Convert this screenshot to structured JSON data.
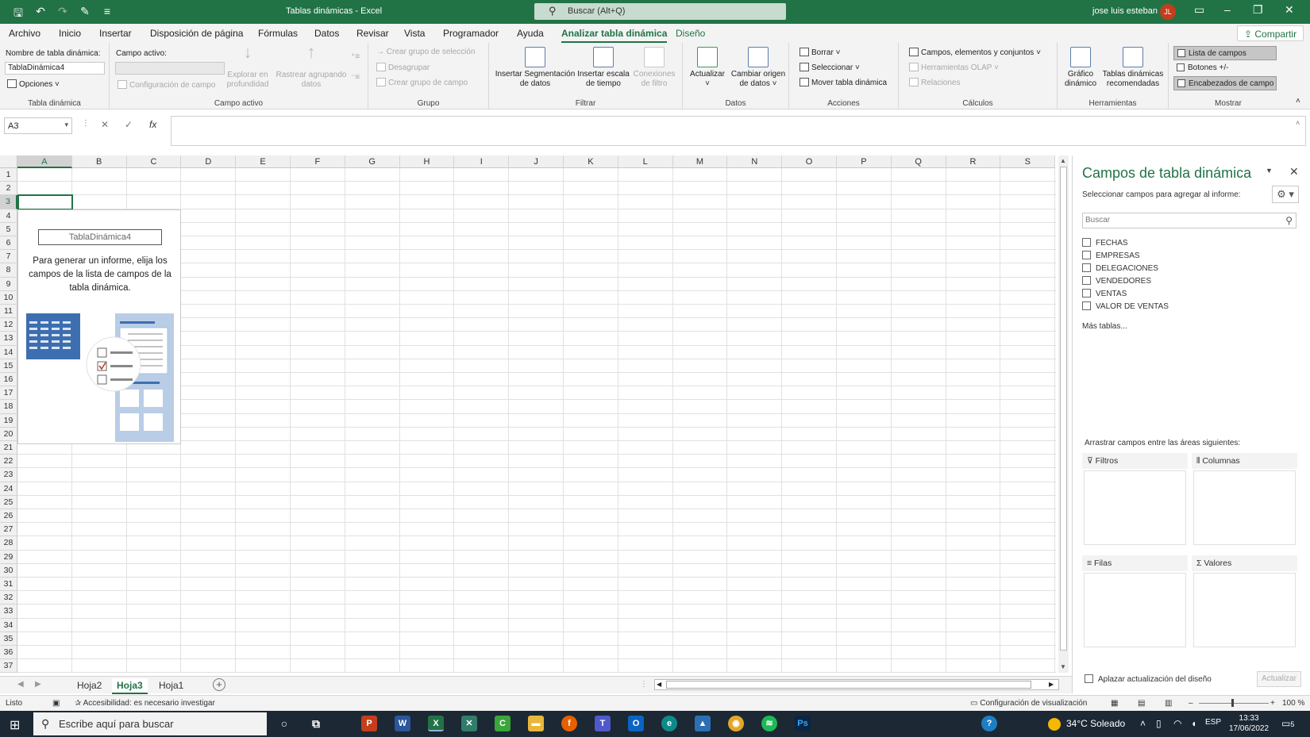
{
  "titlebar": {
    "title": "Tablas dinámicas  -  Excel",
    "search_placeholder": "Buscar (Alt+Q)",
    "user": "jose luis esteban",
    "initials": "JL"
  },
  "menu": {
    "tabs": [
      "Archivo",
      "Inicio",
      "Insertar",
      "Disposición de página",
      "Fórmulas",
      "Datos",
      "Revisar",
      "Vista",
      "Programador",
      "Ayuda",
      "Analizar tabla dinámica",
      "Diseño"
    ],
    "share": "Compartir"
  },
  "ribbon": {
    "tabla": {
      "name_label": "Nombre de tabla dinámica:",
      "name_value": "TablaDinámica4",
      "options": "Opciones",
      "group": "Tabla dinámica"
    },
    "campo": {
      "label": "Campo activo:",
      "config": "Configuración de campo",
      "explore": "Explorar en profundidad",
      "drill": "Rastrear agrupando datos",
      "group": "Campo activo"
    },
    "grupo": {
      "sel": "Crear grupo de selección",
      "desagrupar": "Desagrupar",
      "campo": "Crear grupo de campo",
      "group": "Grupo"
    },
    "filtrar": {
      "seg": "Insertar Segmentación de datos",
      "escala": "Insertar escala de tiempo",
      "conex": "Conexiones de filtro",
      "group": "Filtrar"
    },
    "datos": {
      "act": "Actualizar",
      "origen": "Cambiar origen de datos",
      "group": "Datos"
    },
    "acciones": {
      "borrar": "Borrar",
      "sel": "Seleccionar",
      "mover": "Mover tabla dinámica",
      "group": "Acciones"
    },
    "calculos": {
      "campos": "Campos, elementos y conjuntos",
      "olap": "Herramientas OLAP",
      "rel": "Relaciones",
      "group": "Cálculos"
    },
    "herr": {
      "graf": "Gráfico dinámico",
      "rec": "Tablas dinámicas recomendadas",
      "group": "Herramientas"
    },
    "mostrar": {
      "lista": "Lista de campos",
      "botones": "Botones +/-",
      "encab": "Encabezados de campo",
      "group": "Mostrar"
    }
  },
  "formula": {
    "namebox": "A3",
    "fx": "fx"
  },
  "grid": {
    "columns": [
      "A",
      "B",
      "C",
      "D",
      "E",
      "F",
      "G",
      "H",
      "I",
      "J",
      "K",
      "L",
      "M",
      "N",
      "O",
      "P",
      "Q",
      "R",
      "S"
    ],
    "rows": [
      "1",
      "2",
      "3",
      "4",
      "5",
      "6",
      "7",
      "8",
      "9",
      "10",
      "11",
      "12",
      "13",
      "14",
      "15",
      "16",
      "17",
      "18",
      "19",
      "20",
      "21",
      "22",
      "23",
      "24",
      "25",
      "26",
      "27",
      "28",
      "29",
      "30",
      "31",
      "32",
      "33",
      "34",
      "35",
      "36",
      "37"
    ]
  },
  "pivot": {
    "name": "TablaDinámica4",
    "message": "Para generar un informe, elija los campos de la lista de campos de la tabla dinámica."
  },
  "sheets": {
    "tabs": [
      "Hoja2",
      "Hoja3",
      "Hoja1"
    ],
    "active": "Hoja3"
  },
  "status": {
    "ready": "Listo",
    "access": "Accesibilidad: es necesario investigar",
    "display": "Configuración de visualización",
    "zoom": "100 %"
  },
  "panel": {
    "title": "Campos de tabla dinámica",
    "subtitle": "Seleccionar campos para agregar al informe:",
    "search": "Buscar",
    "fields": [
      "FECHAS",
      "EMPRESAS",
      "DELEGACIONES",
      "VENDEDORES",
      "VENTAS",
      "VALOR DE VENTAS"
    ],
    "more": "Más tablas...",
    "drag": "Arrastrar campos entre las áreas siguientes:",
    "areas": {
      "filtros": "Filtros",
      "columnas": "Columnas",
      "filas": "Filas",
      "valores": "Valores"
    },
    "defer": "Aplazar actualización del diseño",
    "update": "Actualizar"
  },
  "taskbar": {
    "search": "Escribe aquí para buscar",
    "weather": "34°C  Soleado",
    "lang": "ESP",
    "time": "13:33",
    "date": "17/06/2022",
    "notif": "5"
  },
  "colors": {
    "excel_green": "#217346",
    "title_bg": "#217346",
    "avatar": "#c43e1c",
    "taskbar": "#1c2834"
  }
}
